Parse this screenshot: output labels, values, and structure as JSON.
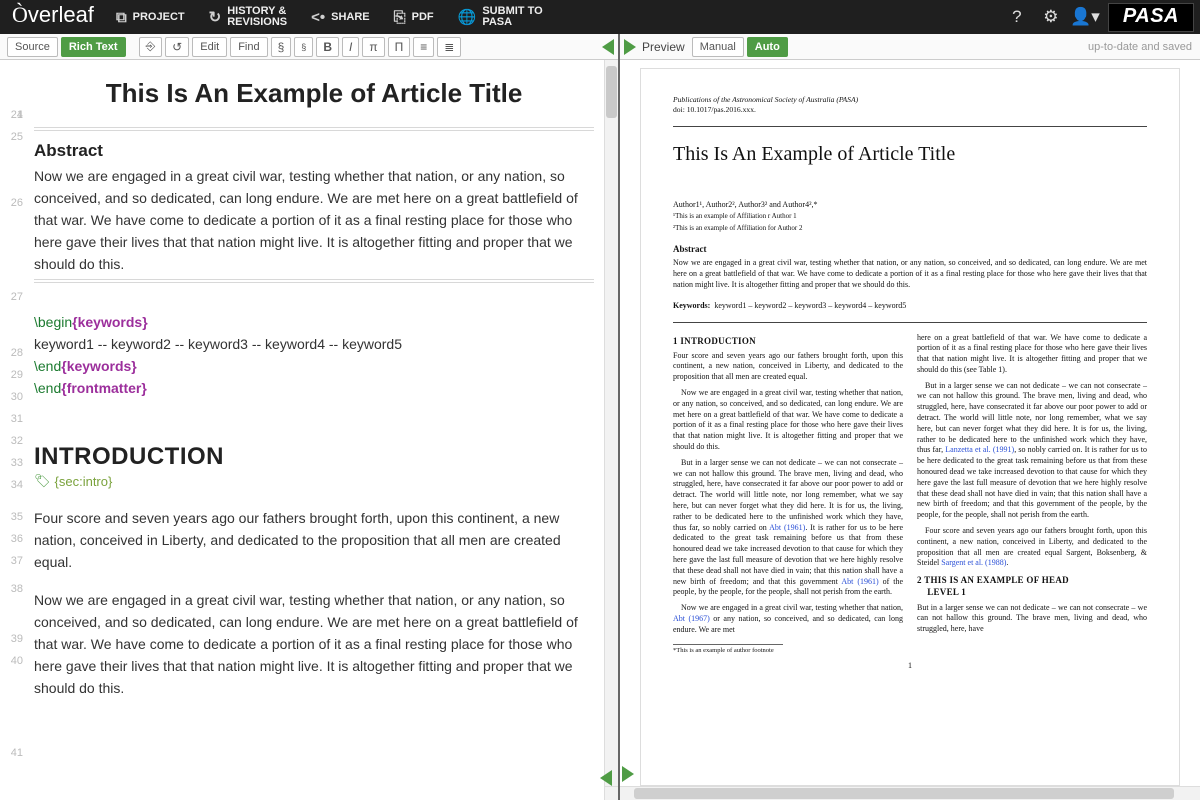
{
  "brand": "Overleaf",
  "partner": "PASA",
  "topnav": {
    "project": "PROJECT",
    "history_l1": "HISTORY &",
    "history_l2": "REVISIONS",
    "share": "SHARE",
    "pdf": "PDF",
    "submit_l1": "SUBMIT TO",
    "submit_l2": "PASA"
  },
  "toolbar": {
    "source": "Source",
    "richtext": "Rich Text",
    "edit": "Edit",
    "find": "Find",
    "preview": "Preview",
    "manual": "Manual",
    "auto": "Auto",
    "status": "up-to-date and saved"
  },
  "editor": {
    "ln": {
      "a": "1",
      "b": "24",
      "c": "25",
      "d": "26",
      "e": "27",
      "f": "28",
      "g": "29",
      "h": "30",
      "i": "31",
      "j": "32",
      "k": "33",
      "l": "34",
      "m": "35",
      "n": "36",
      "o": "37",
      "p": "38",
      "q": "39",
      "r": "40",
      "s": "41"
    },
    "title": "This Is An Example of Article Title",
    "abstract_h": "Abstract",
    "abstract_t": "Now we are engaged in a great civil war, testing whether that nation, or any nation, so conceived, and so dedicated, can long endure. We are met here on a great battlefield of that war. We have come to dedicate a portion of it as a final resting place for those who here gave their lives that that nation might live. It is altogether fitting and proper that we should do this.",
    "begin": "\\begin",
    "end": "\\end",
    "keywords": "{keywords}",
    "frontmatter": "{frontmatter}",
    "keywords_line": "keyword1 -- keyword2 -- keyword3 -- keyword4 -- keyword5",
    "intro_h": "INTRODUCTION",
    "label": "{sec:intro}",
    "p38": "Four score and seven years ago our fathers brought forth, upon this continent, a new nation, conceived in Liberty, and dedicated to the proposition that all men are created equal.",
    "p40": "Now we are engaged in a great civil war, testing whether that nation, or any nation, so conceived, and so dedicated, can long endure. We are met here on a great battlefield of that war. We have come to dedicate a portion of it as a final resting place for those who here gave their lives that that nation might live. It is altogether fitting and proper that we should do this."
  },
  "pdf": {
    "pub": "Publications of the Astronomical Society of Australia (PASA)",
    "doi": "doi: 10.1017/pas.2016.xxx.",
    "title": "This Is An Example of Article Title",
    "authors": "Author1¹, Author2², Author3² and Author4²,*",
    "aff1": "¹This is an example of Affiliation r Author 1",
    "aff2": "²This is an example of Affiliation for Author 2",
    "ab_h": "Abstract",
    "ab_t": "Now we are engaged in a great civil war, testing whether that nation, or any nation, so conceived, and so dedicated, can long endure. We are met here on a great battlefield of that war. We have come to dedicate a portion of it as a final resting place for those who here gave their lives that that nation might live. It is altogether fitting and proper that we should do this.",
    "kw_label": "Keywords:",
    "kw": "keyword1 – keyword2 – keyword3 – keyword4 – keyword5",
    "s1": "1  INTRODUCTION",
    "c1p1": "Four score and seven years ago our fathers brought forth, upon this continent, a new nation, conceived in Liberty, and dedicated to the proposition that all men are created equal.",
    "c1p2": "Now we are engaged in a great civil war, testing whether that nation, or any nation, so conceived, and so dedicated, can long endure. We are met here on a great battlefield of that war. We have come to dedicate a portion of it as a final resting place for those who here gave their lives that that nation might live. It is altogether fitting and proper that we should do this.",
    "c1p3a": "But in a larger sense we can not dedicate – we can not consecrate – we can not hallow this ground. The brave men, living and dead, who struggled, here, have consecrated it far above our poor power to add or detract. The world will little note, nor long remember, what we say here, but can never forget what they did here. It is for us, the living, rather to be dedicated here to the unfinished work which they have, thus far, so nobly carried on ",
    "abt1961": "Abt (1961)",
    "c1p3b": ". It is rather for us to be here dedicated to the great task remaining before us that from these honoured dead we take increased devotion to that cause for which they here gave the last full measure of devotion that we here highly resolve that these dead shall not have died in vain; that this nation shall have a new birth of freedom; and that this government ",
    "c1p3c": " of the people, by the people, for the people, shall not perish from the earth.",
    "c1p4a": "Now we are engaged in a great civil war, testing whether that nation, ",
    "abt1967": "Abt (1967)",
    "c1p4b": " or any nation, so conceived, and so dedicated, can long endure. We are met",
    "c2p1": "here on a great battlefield of that war. We have come to dedicate a portion of it as a final resting place for those who here gave their lives that that nation might live. It is altogether fitting and proper that we should do this (see Table 1).",
    "c2p2a": "But in a larger sense we can not dedicate – we can not consecrate – we can not hallow this ground. The brave men, living and dead, who struggled, here, have consecrated it far above our poor power to add or detract. The world will little note, nor long remember, what we say here, but can never forget what they did here. It is for us, the living, rather to be dedicated here to the unfinished work which they have, thus far, ",
    "lanzetta": "Lanzetta et al. (1991)",
    "c2p2b": ", so nobly carried on. It is rather for us to be here dedicated to the great task remaining before us that from these honoured dead we take increased devotion to that cause for which they here gave the last full measure of devotion that we here highly resolve that these dead shall not have died in vain; that this nation shall have a new birth of freedom; and that this government of the people, by the people, for the people, shall not perish from the earth.",
    "c2p3a": "Four score and seven years ago our fathers brought forth, upon this continent, a new nation, conceived in Liberty, and dedicated to the proposition that all men are created equal Sargent, Boksenberg, & Steidel ",
    "sargent": "Sargent et al. (1988)",
    "c2p3b": ".",
    "s2a": "2  THIS IS AN EXAMPLE OF HEAD",
    "s2b": "LEVEL 1",
    "c2p4": "But in a larger sense we can not dedicate – we can not consecrate – we can not hallow this ground. The brave men, living and dead, who struggled, here, have",
    "footnote": "*This is an example of author footnote",
    "pageno": "1"
  }
}
